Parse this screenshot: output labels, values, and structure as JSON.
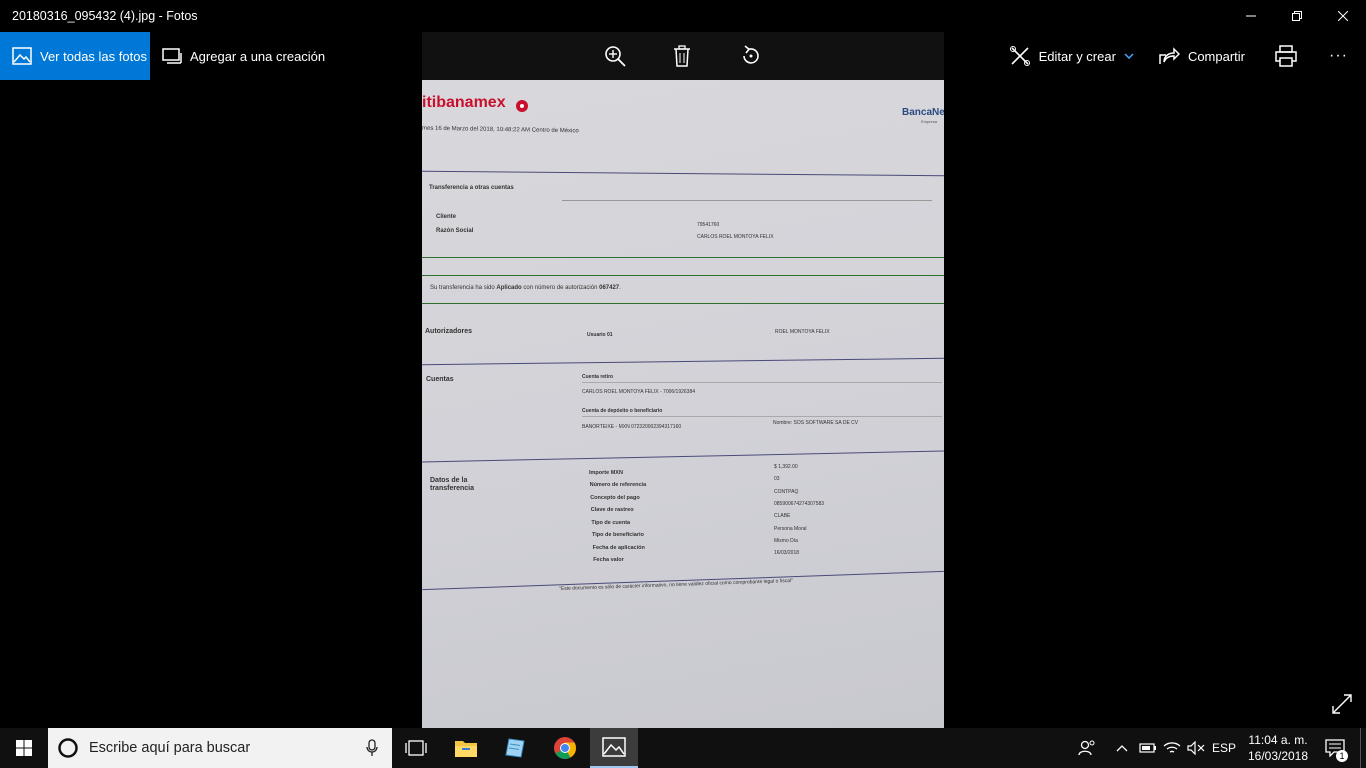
{
  "window": {
    "title": "20180316_095432 (4).jpg - Fotos"
  },
  "toolbar": {
    "all_photos": "Ver todas las fotos",
    "add_to_creation": "Agregar a una creación",
    "edit_create": "Editar y crear",
    "share": "Compartir",
    "more": "···"
  },
  "doc": {
    "brand": "itibanamex",
    "brand_right": "BancaNe",
    "brand_right_sub": "Empresa",
    "date": "mes 16 de Marzo del 2018, 10:48:22 AM Centro de México",
    "section_title": "Transferencia a otras cuentas",
    "cliente_label": "Cliente",
    "razon_label": "Razón Social",
    "cliente_value": "79541760",
    "razon_value": "CARLOS ROEL MONTOYA FELIX",
    "status_prefix": "Su transferencia ha sido ",
    "status_bold": "Aplicado",
    "status_mid": " con número de autorización ",
    "status_auth": "067427",
    "status_end": ".",
    "autorizadores_label": "Autorizadores",
    "usuario_label": "Usuario 01",
    "usuario_value": "ROEL MONTOYA FELIX",
    "cuentas_label": "Cuentas",
    "cuenta_retiro_label": "Cuenta retiro",
    "cuenta_retiro_value": "CARLOS ROEL MONTOYA FELIX - 7006/1926384",
    "cuenta_deposito_label": "Cuenta de depósito o beneficiario",
    "cuenta_deposito_value": "BANORTEIXE - MXN 072320002394317160",
    "nombre_value": "Nombre: SOS SOFTWARE SA DE CV",
    "datos_label_1": "Datos de la",
    "datos_label_2": "transferencia",
    "fields": [
      {
        "label": "Importe MXN",
        "value": "$ 1,392.00"
      },
      {
        "label": "Número de referencia",
        "value": "03"
      },
      {
        "label": "Concepto del pago",
        "value": "CONTPAQ"
      },
      {
        "label": "Clave de rastreo",
        "value": "085900674274307583"
      },
      {
        "label": "Tipo de cuenta",
        "value": "CLABE"
      },
      {
        "label": "Tipo de beneficiario",
        "value": "Persona Moral"
      },
      {
        "label": "Fecha de aplicación",
        "value": "Mismo Día"
      },
      {
        "label": "Fecha valor",
        "value": "16/03/2018"
      }
    ],
    "footer": "\"Este documento es sólo de carácter informativo, no tiene validez oficial como comprobante legal o fiscal\""
  },
  "taskbar": {
    "search_placeholder": "Escribe aquí para buscar",
    "lang": "ESP",
    "time": "11:04 a. m.",
    "date": "16/03/2018",
    "notifications": "1"
  },
  "colors": {
    "accent": "#0078d7",
    "banamex_red": "#c8102e"
  }
}
